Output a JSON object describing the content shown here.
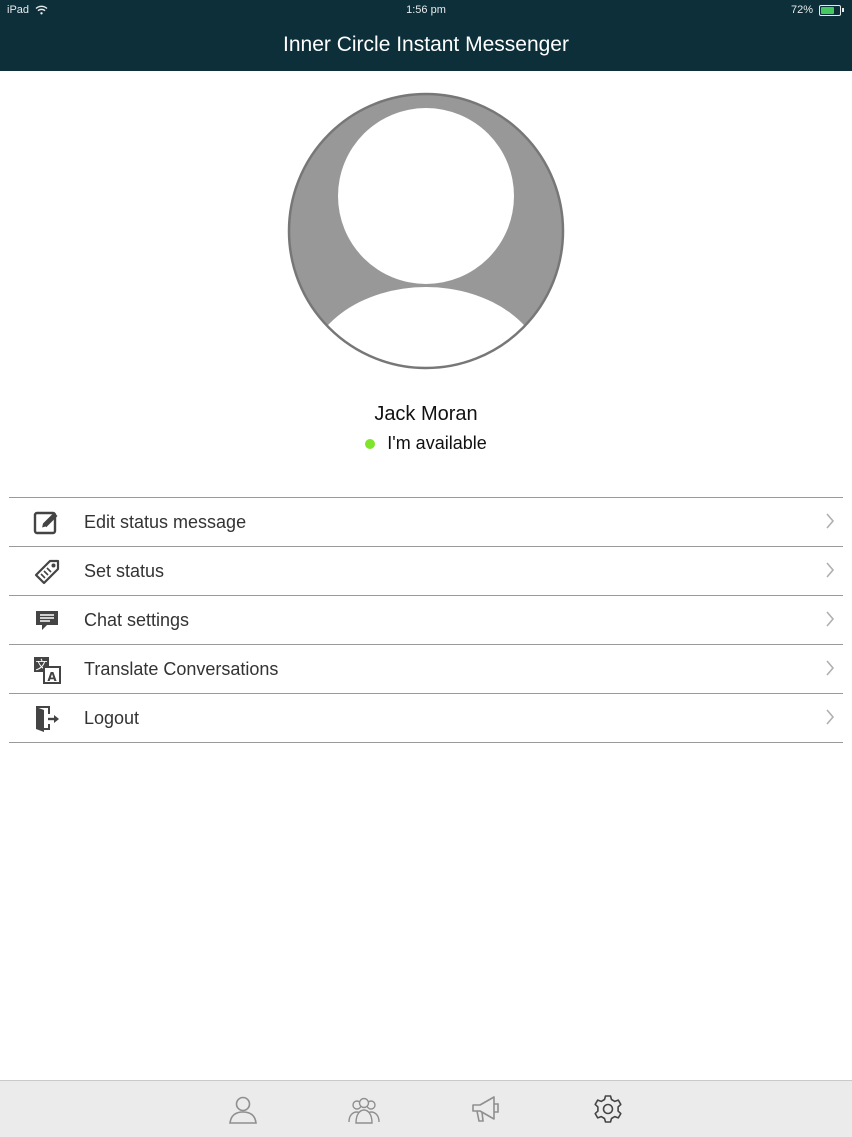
{
  "status_bar": {
    "device": "iPad",
    "time": "1:56 pm",
    "battery_text": "72%",
    "battery_level": 0.72
  },
  "header": {
    "title": "Inner Circle Instant Messenger"
  },
  "profile": {
    "name": "Jack Moran",
    "status_text": "I'm available",
    "status_color": "#7ee52a"
  },
  "menu": {
    "items": [
      {
        "label": "Edit status message",
        "icon": "edit-icon"
      },
      {
        "label": "Set status",
        "icon": "tag-icon"
      },
      {
        "label": "Chat settings",
        "icon": "chat-bubble-icon"
      },
      {
        "label": "Translate Conversations",
        "icon": "translate-icon"
      },
      {
        "label": "Logout",
        "icon": "logout-icon"
      }
    ]
  },
  "tab_bar": {
    "tabs": [
      {
        "icon": "contact-icon"
      },
      {
        "icon": "group-icon"
      },
      {
        "icon": "megaphone-icon"
      },
      {
        "icon": "settings-gear-icon",
        "active": true
      }
    ]
  },
  "colors": {
    "header_bg": "#0c2f39",
    "available": "#7ee52a"
  }
}
